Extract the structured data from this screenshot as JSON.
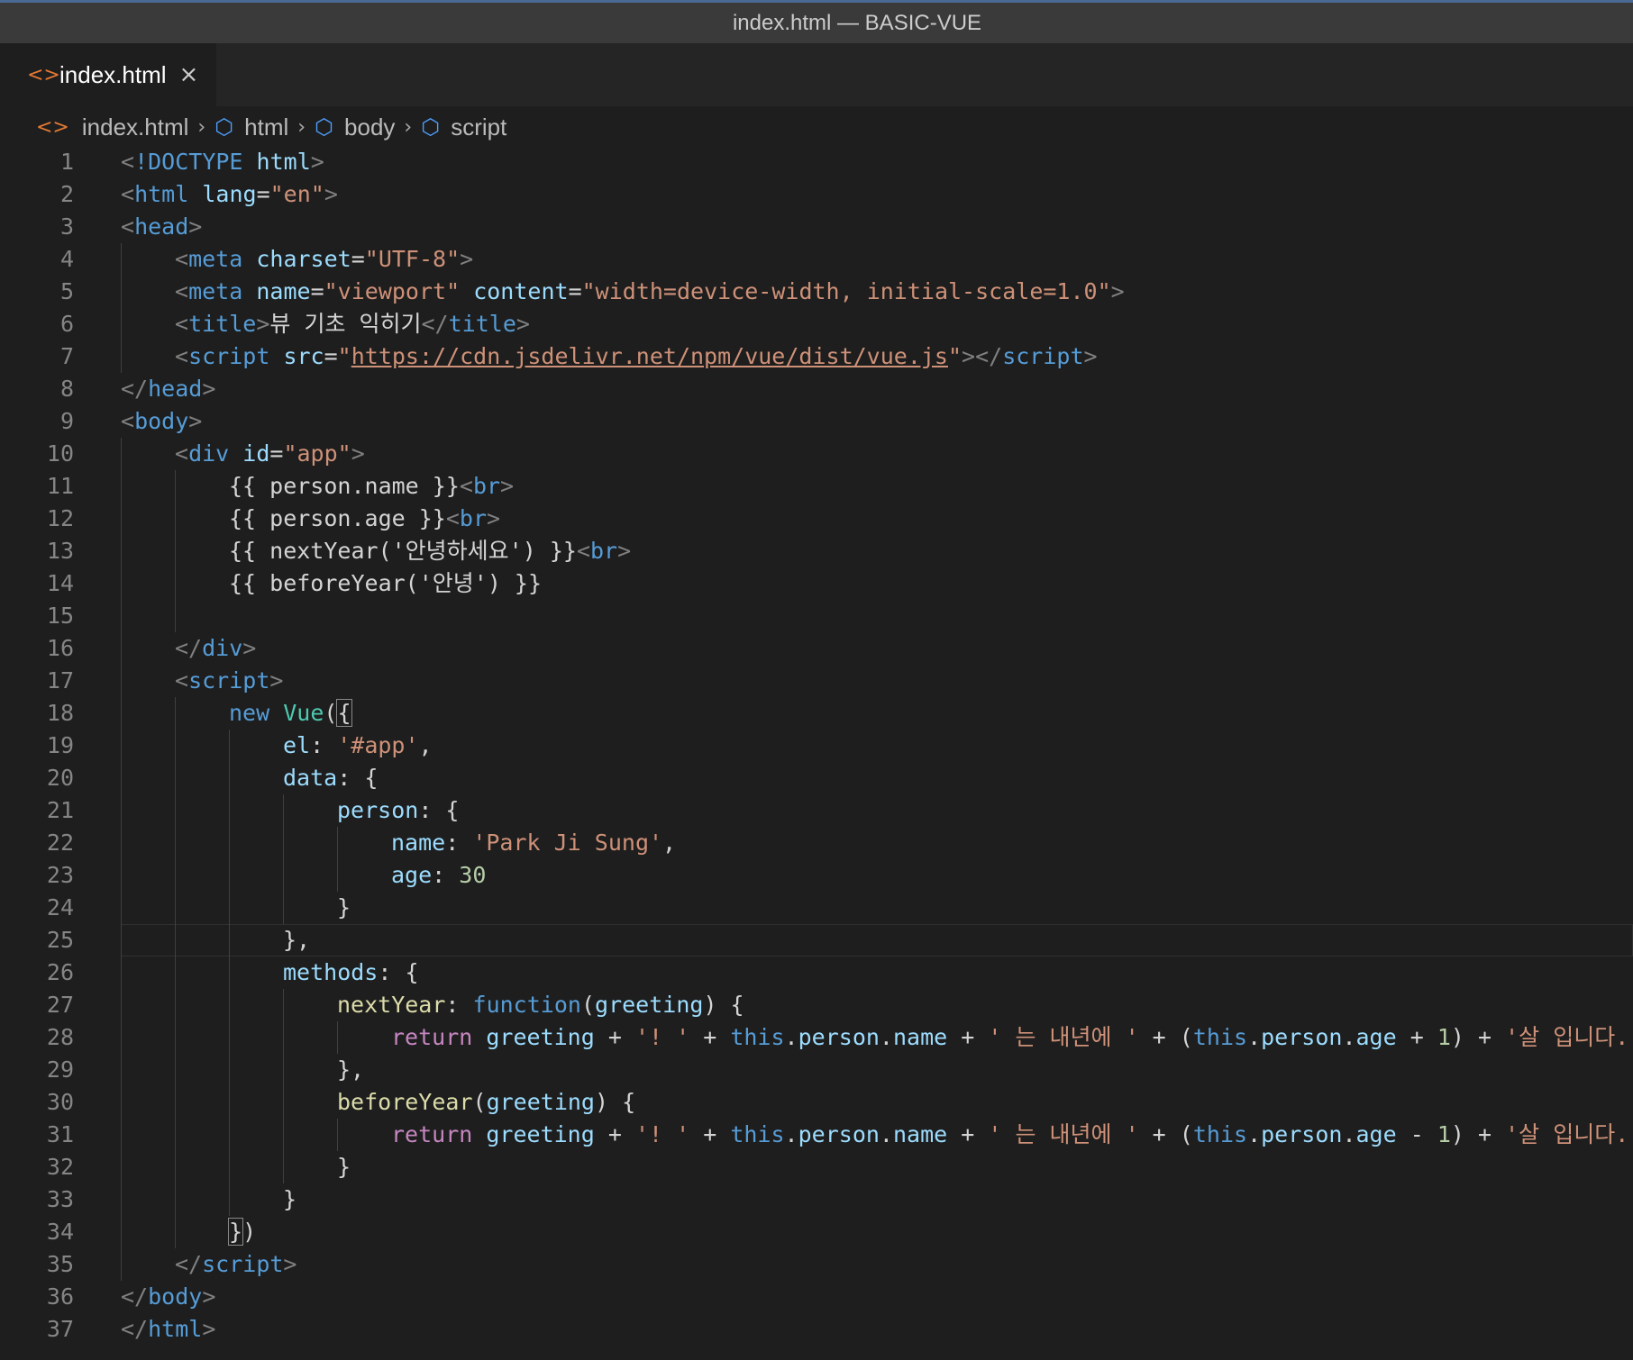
{
  "window": {
    "title": "index.html — BASIC-VUE"
  },
  "tab": {
    "label": "index.html",
    "icon": "<>",
    "close": "×"
  },
  "breadcrumb": {
    "file": "index.html",
    "items": [
      "html",
      "body",
      "script"
    ]
  },
  "colors": {
    "tag": "#569cd6",
    "attribute": "#9cdcfe",
    "string": "#ce9178",
    "keyword": "#569cd6",
    "control": "#c586c0",
    "class": "#4ec9b0",
    "function": "#dcdcaa",
    "number": "#b5cea8",
    "text": "#d4d4d4",
    "line_number": "#858585",
    "file_icon": "#e37933",
    "symbol_icon": "#4fa0ff"
  },
  "editor": {
    "current_line": 25,
    "lines": [
      {
        "n": "1",
        "indent": 0,
        "tokens": [
          [
            "br",
            "<"
          ],
          [
            "doct",
            "!DOCTYPE"
          ],
          [
            "txt",
            " "
          ],
          [
            "attr",
            "html"
          ],
          [
            "br",
            ">"
          ]
        ]
      },
      {
        "n": "2",
        "indent": 0,
        "tokens": [
          [
            "br",
            "<"
          ],
          [
            "tag",
            "html"
          ],
          [
            "txt",
            " "
          ],
          [
            "attr",
            "lang"
          ],
          [
            "txt",
            "="
          ],
          [
            "str",
            "\"en\""
          ],
          [
            "br",
            ">"
          ]
        ]
      },
      {
        "n": "3",
        "indent": 0,
        "tokens": [
          [
            "br",
            "<"
          ],
          [
            "tag",
            "head"
          ],
          [
            "br",
            ">"
          ]
        ]
      },
      {
        "n": "4",
        "indent": 1,
        "tokens": [
          [
            "br",
            "<"
          ],
          [
            "tag",
            "meta"
          ],
          [
            "txt",
            " "
          ],
          [
            "attr",
            "charset"
          ],
          [
            "txt",
            "="
          ],
          [
            "str",
            "\"UTF-8\""
          ],
          [
            "br",
            ">"
          ]
        ]
      },
      {
        "n": "5",
        "indent": 1,
        "tokens": [
          [
            "br",
            "<"
          ],
          [
            "tag",
            "meta"
          ],
          [
            "txt",
            " "
          ],
          [
            "attr",
            "name"
          ],
          [
            "txt",
            "="
          ],
          [
            "str",
            "\"viewport\""
          ],
          [
            "txt",
            " "
          ],
          [
            "attr",
            "content"
          ],
          [
            "txt",
            "="
          ],
          [
            "str",
            "\"width=device-width, initial-scale=1.0\""
          ],
          [
            "br",
            ">"
          ]
        ]
      },
      {
        "n": "6",
        "indent": 1,
        "tokens": [
          [
            "br",
            "<"
          ],
          [
            "tag",
            "title"
          ],
          [
            "br",
            ">"
          ],
          [
            "txt",
            "뷰 기초 익히기"
          ],
          [
            "br",
            "</"
          ],
          [
            "tag",
            "title"
          ],
          [
            "br",
            ">"
          ]
        ]
      },
      {
        "n": "7",
        "indent": 1,
        "tokens": [
          [
            "br",
            "<"
          ],
          [
            "tag",
            "script"
          ],
          [
            "txt",
            " "
          ],
          [
            "attr",
            "src"
          ],
          [
            "txt",
            "="
          ],
          [
            "str",
            "\""
          ],
          [
            "url",
            "https://cdn.jsdelivr.net/npm/vue/dist/vue.js"
          ],
          [
            "str",
            "\""
          ],
          [
            "br",
            "></"
          ],
          [
            "tag",
            "script"
          ],
          [
            "br",
            ">"
          ]
        ]
      },
      {
        "n": "8",
        "indent": 0,
        "tokens": [
          [
            "br",
            "</"
          ],
          [
            "tag",
            "head"
          ],
          [
            "br",
            ">"
          ]
        ]
      },
      {
        "n": "9",
        "indent": 0,
        "tokens": [
          [
            "br",
            "<"
          ],
          [
            "tag",
            "body"
          ],
          [
            "br",
            ">"
          ]
        ]
      },
      {
        "n": "10",
        "indent": 1,
        "tokens": [
          [
            "br",
            "<"
          ],
          [
            "tag",
            "div"
          ],
          [
            "txt",
            " "
          ],
          [
            "attr",
            "id"
          ],
          [
            "txt",
            "="
          ],
          [
            "str",
            "\"app\""
          ],
          [
            "br",
            ">"
          ]
        ]
      },
      {
        "n": "11",
        "indent": 2,
        "tokens": [
          [
            "txt",
            "{{ person.name }}"
          ],
          [
            "br",
            "<"
          ],
          [
            "tag",
            "br"
          ],
          [
            "br",
            ">"
          ]
        ]
      },
      {
        "n": "12",
        "indent": 2,
        "tokens": [
          [
            "txt",
            "{{ person.age }}"
          ],
          [
            "br",
            "<"
          ],
          [
            "tag",
            "br"
          ],
          [
            "br",
            ">"
          ]
        ]
      },
      {
        "n": "13",
        "indent": 2,
        "tokens": [
          [
            "txt",
            "{{ nextYear('안녕하세요') }}"
          ],
          [
            "br",
            "<"
          ],
          [
            "tag",
            "br"
          ],
          [
            "br",
            ">"
          ]
        ]
      },
      {
        "n": "14",
        "indent": 2,
        "tokens": [
          [
            "txt",
            "{{ beforeYear('안녕') }}"
          ]
        ]
      },
      {
        "n": "15",
        "indent": 2,
        "tokens": []
      },
      {
        "n": "16",
        "indent": 1,
        "tokens": [
          [
            "br",
            "</"
          ],
          [
            "tag",
            "div"
          ],
          [
            "br",
            ">"
          ]
        ]
      },
      {
        "n": "17",
        "indent": 1,
        "tokens": [
          [
            "br",
            "<"
          ],
          [
            "tag",
            "script"
          ],
          [
            "br",
            ">"
          ]
        ]
      },
      {
        "n": "18",
        "indent": 2,
        "tokens": [
          [
            "kw",
            "new"
          ],
          [
            "txt",
            " "
          ],
          [
            "cls",
            "Vue"
          ],
          [
            "txt",
            "("
          ],
          [
            "bm",
            "{"
          ]
        ]
      },
      {
        "n": "19",
        "indent": 3,
        "tokens": [
          [
            "prop",
            "el"
          ],
          [
            "txt",
            ": "
          ],
          [
            "str",
            "'#app'"
          ],
          [
            "txt",
            ","
          ]
        ]
      },
      {
        "n": "20",
        "indent": 3,
        "tokens": [
          [
            "prop",
            "data"
          ],
          [
            "txt",
            ": {"
          ]
        ]
      },
      {
        "n": "21",
        "indent": 4,
        "tokens": [
          [
            "prop",
            "person"
          ],
          [
            "txt",
            ": {"
          ]
        ]
      },
      {
        "n": "22",
        "indent": 5,
        "tokens": [
          [
            "prop",
            "name"
          ],
          [
            "txt",
            ": "
          ],
          [
            "str",
            "'Park Ji Sung'"
          ],
          [
            "txt",
            ","
          ]
        ]
      },
      {
        "n": "23",
        "indent": 5,
        "tokens": [
          [
            "prop",
            "age"
          ],
          [
            "txt",
            ": "
          ],
          [
            "num",
            "30"
          ]
        ]
      },
      {
        "n": "24",
        "indent": 4,
        "tokens": [
          [
            "txt",
            "}"
          ]
        ]
      },
      {
        "n": "25",
        "indent": 3,
        "tokens": [
          [
            "txt",
            "},"
          ]
        ]
      },
      {
        "n": "26",
        "indent": 3,
        "tokens": [
          [
            "prop",
            "methods"
          ],
          [
            "txt",
            ": {"
          ]
        ]
      },
      {
        "n": "27",
        "indent": 4,
        "tokens": [
          [
            "fn",
            "nextYear"
          ],
          [
            "txt",
            ": "
          ],
          [
            "kw",
            "function"
          ],
          [
            "txt",
            "("
          ],
          [
            "prop",
            "greeting"
          ],
          [
            "txt",
            ") {"
          ]
        ]
      },
      {
        "n": "28",
        "indent": 5,
        "tokens": [
          [
            "ctl",
            "return"
          ],
          [
            "txt",
            " "
          ],
          [
            "prop",
            "greeting"
          ],
          [
            "txt",
            " + "
          ],
          [
            "str",
            "'! '"
          ],
          [
            "txt",
            " + "
          ],
          [
            "kw",
            "this"
          ],
          [
            "txt",
            "."
          ],
          [
            "prop",
            "person"
          ],
          [
            "txt",
            "."
          ],
          [
            "prop",
            "name"
          ],
          [
            "txt",
            " + "
          ],
          [
            "str",
            "' 는 내년에 '"
          ],
          [
            "txt",
            " + ("
          ],
          [
            "kw",
            "this"
          ],
          [
            "txt",
            "."
          ],
          [
            "prop",
            "person"
          ],
          [
            "txt",
            "."
          ],
          [
            "prop",
            "age"
          ],
          [
            "txt",
            " + "
          ],
          [
            "num",
            "1"
          ],
          [
            "txt",
            ") + "
          ],
          [
            "str",
            "'살 입니다.'"
          ],
          [
            "txt",
            ";"
          ]
        ]
      },
      {
        "n": "29",
        "indent": 4,
        "tokens": [
          [
            "txt",
            "},"
          ]
        ]
      },
      {
        "n": "30",
        "indent": 4,
        "tokens": [
          [
            "fn",
            "beforeYear"
          ],
          [
            "txt",
            "("
          ],
          [
            "prop",
            "greeting"
          ],
          [
            "txt",
            ") {"
          ]
        ]
      },
      {
        "n": "31",
        "indent": 5,
        "tokens": [
          [
            "ctl",
            "return"
          ],
          [
            "txt",
            " "
          ],
          [
            "prop",
            "greeting"
          ],
          [
            "txt",
            " + "
          ],
          [
            "str",
            "'! '"
          ],
          [
            "txt",
            " + "
          ],
          [
            "kw",
            "this"
          ],
          [
            "txt",
            "."
          ],
          [
            "prop",
            "person"
          ],
          [
            "txt",
            "."
          ],
          [
            "prop",
            "name"
          ],
          [
            "txt",
            " + "
          ],
          [
            "str",
            "' 는 내년에 '"
          ],
          [
            "txt",
            " + ("
          ],
          [
            "kw",
            "this"
          ],
          [
            "txt",
            "."
          ],
          [
            "prop",
            "person"
          ],
          [
            "txt",
            "."
          ],
          [
            "prop",
            "age"
          ],
          [
            "txt",
            " - "
          ],
          [
            "num",
            "1"
          ],
          [
            "txt",
            ") + "
          ],
          [
            "str",
            "'살 입니다.'"
          ],
          [
            "txt",
            ";"
          ]
        ]
      },
      {
        "n": "32",
        "indent": 4,
        "tokens": [
          [
            "txt",
            "}"
          ]
        ]
      },
      {
        "n": "33",
        "indent": 3,
        "tokens": [
          [
            "txt",
            "}"
          ]
        ]
      },
      {
        "n": "34",
        "indent": 2,
        "tokens": [
          [
            "bm",
            "}"
          ],
          [
            "txt",
            ")"
          ]
        ]
      },
      {
        "n": "35",
        "indent": 1,
        "tokens": [
          [
            "br",
            "</"
          ],
          [
            "tag",
            "script"
          ],
          [
            "br",
            ">"
          ]
        ]
      },
      {
        "n": "36",
        "indent": 0,
        "tokens": [
          [
            "br",
            "</"
          ],
          [
            "tag",
            "body"
          ],
          [
            "br",
            ">"
          ]
        ]
      },
      {
        "n": "37",
        "indent": 0,
        "tokens": [
          [
            "br",
            "</"
          ],
          [
            "tag",
            "html"
          ],
          [
            "br",
            ">"
          ]
        ]
      }
    ]
  }
}
